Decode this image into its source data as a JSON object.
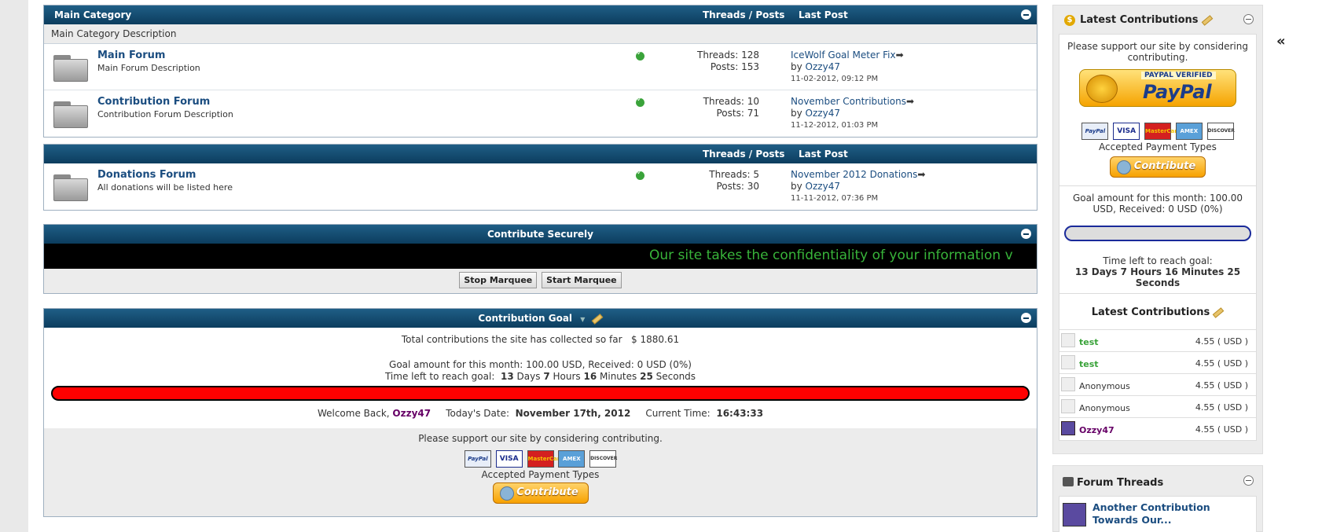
{
  "main_category": {
    "title": "Main Category",
    "description": "Main Category Description",
    "col_threads_posts": "Threads / Posts",
    "col_last_post": "Last Post",
    "forums": [
      {
        "name": "Main Forum",
        "description": "Main Forum Description",
        "threads": "Threads: 128",
        "posts": "Posts: 153",
        "last_title": "IceWolf Goal Meter Fix",
        "by": "by",
        "last_user": "Ozzy47",
        "last_date": "11-02-2012, 09:12 PM"
      },
      {
        "name": "Contribution Forum",
        "description": "Contribution Forum Description",
        "threads": "Threads: 10",
        "posts": "Posts: 71",
        "last_title": "November Contributions",
        "by": "by",
        "last_user": "Ozzy47",
        "last_date": "11-12-2012, 01:03 PM"
      }
    ]
  },
  "donations_category": {
    "col_threads_posts": "Threads / Posts",
    "col_last_post": "Last Post",
    "forums": [
      {
        "name": "Donations Forum",
        "description": "All donations will be listed here",
        "threads": "Threads: 5",
        "posts": "Posts: 30",
        "last_title": "November 2012 Donations",
        "by": "by",
        "last_user": "Ozzy47",
        "last_date": "11-11-2012, 07:36 PM"
      }
    ]
  },
  "contribute_securely": {
    "title": "Contribute Securely",
    "marquee_text": "Our site takes the confidentiality of your information v",
    "stop_label": "Stop Marquee",
    "start_label": "Start Marquee"
  },
  "contribution_goal": {
    "title": "Contribution Goal",
    "total_text": "Total contributions the site has collected so far",
    "total_amount": "$ 1880.61",
    "goal_text": "Goal amount for this month: 100.00 USD, Received: 0 USD (0%)",
    "time_prefix": "Time left to reach goal:",
    "days": "13",
    "days_label": "Days",
    "hours": "7",
    "hours_label": "Hours",
    "minutes": "16",
    "minutes_label": "Minutes",
    "seconds": "25",
    "seconds_label": "Seconds",
    "progress_fraction": 0,
    "welcome_prefix": "Welcome Back,",
    "welcome_user": "Ozzy47",
    "date_label": "Today's Date:",
    "date_value": "November 17th, 2012",
    "time_label": "Current Time:",
    "time_value": "16:43:33",
    "support_text": "Please support our site by considering contributing.",
    "accepted_text": "Accepted Payment Types",
    "contribute_label": "Contribute"
  },
  "payment_cards": [
    "PayPal",
    "VISA",
    "MasterCard",
    "AMEX",
    "DISCOVER"
  ],
  "sidebar": {
    "latest_title": "Latest Contributions",
    "support_text": "Please support our site by considering contributing.",
    "paypal_verified": "PAYPAL VERIFIED",
    "paypal_word": "PayPal",
    "accepted_text": "Accepted Payment Types",
    "contribute_label": "Contribute",
    "goal_text": "Goal amount for this month: 100.00 USD, Received: 0 USD (0%)",
    "time_prefix": "Time left to reach goal:",
    "time_value": "13 Days 7 Hours 16 Minutes 25 Seconds",
    "inner_latest_title": "Latest Contributions",
    "contributions": [
      {
        "name": "test",
        "amount": "4.55 ( USD )",
        "style": "green"
      },
      {
        "name": "test",
        "amount": "4.55 ( USD )",
        "style": "green"
      },
      {
        "name": "Anonymous",
        "amount": "4.55 ( USD )",
        "style": "plain"
      },
      {
        "name": "Anonymous",
        "amount": "4.55 ( USD )",
        "style": "plain"
      },
      {
        "name": "Ozzy47",
        "amount": "4.55 ( USD )",
        "style": "purple"
      }
    ],
    "forum_threads_title": "Forum Threads",
    "thread_title": "Another Contribution Towards Our..."
  },
  "colors": {
    "header_dark": "#0c3d5e",
    "link_blue": "#1b4d80",
    "marquee_green": "#38b43a",
    "goal_red": "#ff0000",
    "user_purple": "#660066"
  }
}
